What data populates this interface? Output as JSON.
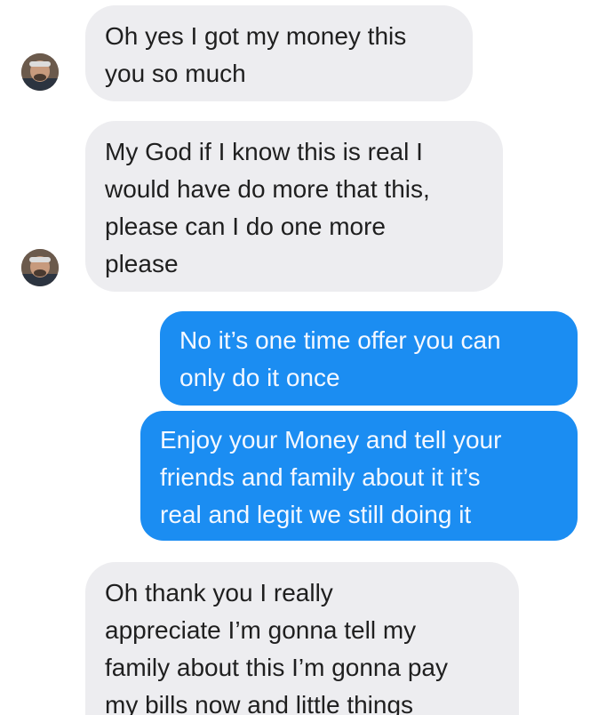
{
  "conversation": {
    "messages": [
      {
        "sender": "contact",
        "text": "Oh yes I got my money this\nyou so much"
      },
      {
        "sender": "contact",
        "text": "My God if I know this is real I\nwould have do more that this,\nplease can I do one more\nplease"
      },
      {
        "sender": "me",
        "text": "No it’s one time offer you can\nonly do it once"
      },
      {
        "sender": "me",
        "text": "Enjoy your Money and tell your\nfriends and family about it it’s\nreal and legit we still doing it"
      },
      {
        "sender": "contact",
        "text": "Oh thank you I really\nappreciate I’m gonna tell my\nfamily about this I’m gonna pay\nmy bills now and little things"
      }
    ]
  },
  "colors": {
    "incoming_bubble": "#ededf0",
    "outgoing_bubble": "#1b8df2",
    "incoming_text": "#1f1f1f",
    "outgoing_text": "#f4f8ff"
  },
  "icons": {
    "contact_avatar": "contact-avatar-icon"
  }
}
